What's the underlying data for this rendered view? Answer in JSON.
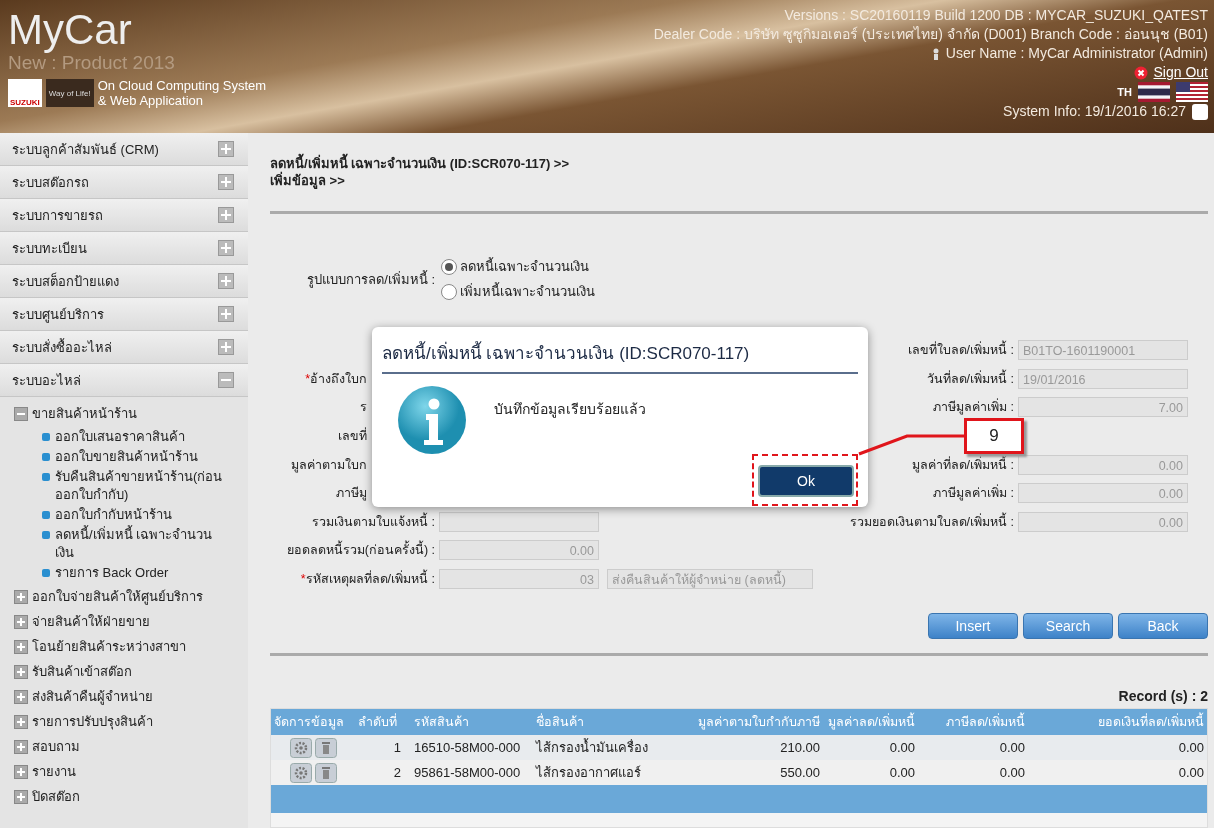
{
  "header": {
    "logo": "MyCar",
    "product": "New : Product 2013",
    "brand_badge": "SUZUKI",
    "slogan_badge": "Way of Life!",
    "tagline_1": "On Cloud Computing System",
    "tagline_2": "& Web Application",
    "versions": "Versions : SC20160119 Build 1200 DB : MYCAR_SUZUKI_QATEST",
    "dealer": "Dealer Code : บริษัท ซูซูกิมอเตอร์ (ประเทศไทย) จำกัด (D001)  Branch Code : อ่อนนุช (B01)",
    "user": "User Name : MyCar Administrator  (Admin)",
    "sign_out": "Sign Out",
    "language": "TH",
    "system_info": "System Info: 19/1/2016 16:27",
    "system_checkbox_checked": false
  },
  "sidebar": {
    "sections": [
      {
        "label": "ระบบลูกค้าสัมพันธ์ (CRM)",
        "expanded": false
      },
      {
        "label": "ระบบสต๊อกรถ",
        "expanded": false
      },
      {
        "label": "ระบบการขายรถ",
        "expanded": false
      },
      {
        "label": "ระบบทะเบียน",
        "expanded": false
      },
      {
        "label": "ระบบสต็อกป้ายแดง",
        "expanded": false
      },
      {
        "label": "ระบบศูนย์บริการ",
        "expanded": false
      },
      {
        "label": "ระบบสั่งซื้ออะไหล่",
        "expanded": false
      },
      {
        "label": "ระบบอะไหล่",
        "expanded": true
      }
    ],
    "tree": [
      {
        "label": "ขายสินค้าหน้าร้าน",
        "expanded": true,
        "children": [
          {
            "label": "ออกใบเสนอราคาสินค้า"
          },
          {
            "label": "ออกใบขายสินค้าหน้าร้าน"
          },
          {
            "label": "รับคืนสินค้าขายหน้าร้าน(ก่อน ออกใบกำกับ)"
          },
          {
            "label": "ออกใบกำกับหน้าร้าน"
          },
          {
            "label": "ลดหนี้/เพิ่มหนี้ เฉพาะจำนวน เงิน"
          },
          {
            "label": "รายการ Back Order"
          }
        ]
      },
      {
        "label": "ออกใบจ่ายสินค้าให้ศูนย์บริการ",
        "expanded": false
      },
      {
        "label": "จ่ายสินค้าให้ฝ่ายขาย",
        "expanded": false
      },
      {
        "label": "โอนย้ายสินค้าระหว่างสาขา",
        "expanded": false
      },
      {
        "label": "รับสินค้าเข้าสต๊อก",
        "expanded": false
      },
      {
        "label": "ส่งสินค้าคืนผู้จำหน่าย",
        "expanded": false
      },
      {
        "label": "รายการปรับปรุงสินค้า",
        "expanded": false
      },
      {
        "label": "สอบถาม",
        "expanded": false
      },
      {
        "label": "รายงาน",
        "expanded": false
      },
      {
        "label": "ปิดสต๊อก",
        "expanded": false
      }
    ]
  },
  "page": {
    "breadcrumb_1": "ลดหนี้/เพิ่มหนี้ เฉพาะจำนวนเงิน (ID:SCR070-117) >>",
    "breadcrumb_2": "เพิ่มข้อมูล >>",
    "type_label": "รูปแบบการลด/เพิ่มหนี้ :",
    "type_options": [
      {
        "label": "ลดหนี้เฉพาะจำนวนเงิน",
        "selected": true
      },
      {
        "label": "เพิ่มหนี้เฉพาะจำนวนเงิน",
        "selected": false
      }
    ],
    "rows": [
      {
        "right": {
          "label": "เลขที่ใบลด/เพิ่มหนี้ :",
          "value": "B01TO-1601190001"
        }
      },
      {
        "left": {
          "kind": "covered",
          "marker": "*",
          "label": "อ้างถึงใบก"
        },
        "right": {
          "label": "วันที่ลด/เพิ่มหนี้ :",
          "value": "19/01/2016"
        }
      },
      {
        "left": {
          "kind": "covered",
          "label": "ร"
        },
        "right": {
          "label": "ภาษีมูลค่าเพิ่ม :",
          "value": "7.00"
        }
      },
      {
        "left": {
          "kind": "covered",
          "label": "เลขที่"
        }
      },
      {
        "left": {
          "kind": "covered",
          "label": "มูลค่าตามใบก"
        },
        "right": {
          "label": "มูลค่าที่ลด/เพิ่มหนี้ :",
          "value": "0.00"
        }
      },
      {
        "left": {
          "kind": "covered",
          "label": "ภาษีมู"
        },
        "right": {
          "label": "ภาษีมูลค่าเพิ่ม :",
          "value": "0.00"
        }
      },
      {
        "left": {
          "kind": "field",
          "label": "รวมเงินตามใบแจ้งหนี้ :"
        },
        "right": {
          "label": "รวมยอดเงินตามใบลด/เพิ่มหนี้ :",
          "value": "0.00"
        }
      },
      {
        "left": {
          "kind": "field",
          "label": "ยอดลดหนี้รวม(ก่อนครั้งนี้) :",
          "value": "0.00"
        }
      },
      {
        "left": {
          "kind": "field",
          "marker": "*",
          "label": "รหัสเหตุผลที่ลด/เพิ่มหนี้ :",
          "value": "03",
          "description": "ส่งคืนสินค้าให้ผู้จำหน่าย (ลดหนี้)"
        }
      }
    ],
    "buttons": [
      "Insert",
      "Search",
      "Back"
    ],
    "record_count": "Record (s) : 2",
    "table": {
      "columns": [
        "จัดการข้อมูล",
        "ลำดับที่",
        "รหัสสินค้า",
        "ชื่อสินค้า",
        "มูลค่าตามใบกำกับภาษี",
        "มูลค่าลด/เพิ่มหนี้",
        "ภาษีลด/เพิ่มหนี้",
        "ยอดเงินที่ลด/เพิ่มหนี้"
      ],
      "rows": [
        {
          "no": "1",
          "code": "16510-58M00-000",
          "name": "ไส้กรองน้ำมันเครื่อง",
          "invoice": "210.00",
          "amount": "0.00",
          "tax": "0.00",
          "total": "0.00"
        },
        {
          "no": "2",
          "code": "95861-58M00-000",
          "name": "ไส้กรองอากาศแอร์",
          "invoice": "550.00",
          "amount": "0.00",
          "tax": "0.00",
          "total": "0.00"
        }
      ]
    }
  },
  "dialog": {
    "title": "ลดหนี้/เพิ่มหนี้ เฉพาะจำนวนเงิน (ID:SCR070-117)",
    "message": "บันทึกข้อมูลเรียบร้อยแล้ว",
    "button": "Ok"
  },
  "callout": {
    "number": "9"
  }
}
